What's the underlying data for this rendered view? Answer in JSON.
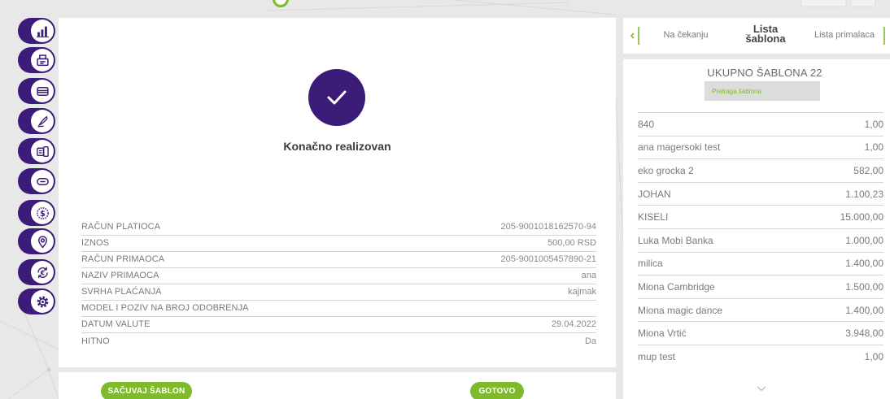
{
  "colors": {
    "brand_purple": "#3b1c78",
    "brand_green": "#7fba2c",
    "text_grey": "#777777",
    "search_background": "#dcdcdc"
  },
  "sidebar": {
    "items": [
      {
        "icon": "bar-chart-icon"
      },
      {
        "icon": "printer-icon"
      },
      {
        "icon": "card-icon"
      },
      {
        "icon": "pen-icon"
      },
      {
        "icon": "transfer-icon"
      },
      {
        "icon": "minus-icon"
      },
      {
        "icon": "dollar-icon"
      },
      {
        "icon": "location-pin-icon"
      },
      {
        "icon": "euro-exchange-icon"
      },
      {
        "icon": "gear-icon"
      }
    ]
  },
  "confirmation": {
    "icon": "check-icon",
    "status_text": "Konačno realizovan"
  },
  "details": [
    {
      "label": "RAČUN PLATIOCA",
      "value": "205-9001018162570-94"
    },
    {
      "label": "IZNOS",
      "value": "500,00 RSD"
    },
    {
      "label": "RAČUN PRIMAOCA",
      "value": "205-9001005457890-21"
    },
    {
      "label": "NAZIV PRIMAOCA",
      "value": "ana"
    },
    {
      "label": "SVRHA PLAĆANJA",
      "value": "kajmak"
    },
    {
      "label": "MODEL I POZIV NA BROJ ODOBRENJA",
      "value": ""
    },
    {
      "label": "DATUM VALUTE",
      "value": "29.04.2022"
    },
    {
      "label": "HITNO",
      "value": "Da"
    }
  ],
  "actions": {
    "save_template_label": "SAČUVAJ ŠABLON",
    "done_label": "GOTOVO"
  },
  "tabs": {
    "prev_icon": "chevron-left-icon",
    "next_icon": "chevron-right-icon",
    "items": [
      {
        "label": "Na čekanju",
        "active": false
      },
      {
        "label": "Lista šablona",
        "active": true
      },
      {
        "label": "Lista primalaca",
        "active": false
      }
    ]
  },
  "templates": {
    "total_label": "UKUPNO ŠABLONA",
    "total_count": 22,
    "search_placeholder": "Pretraga šablona",
    "more_icon": "chevron-down-icon",
    "items": [
      {
        "name": "840",
        "amount": "1,00"
      },
      {
        "name": "ana magersoki test",
        "amount": "1,00"
      },
      {
        "name": "eko grocka 2",
        "amount": "582,00"
      },
      {
        "name": "JOHAN",
        "amount": "1.100,23"
      },
      {
        "name": "KISELI",
        "amount": "15.000,00"
      },
      {
        "name": "Luka Mobi Banka",
        "amount": "1.000,00"
      },
      {
        "name": "milica",
        "amount": "1.400,00"
      },
      {
        "name": "Miona Cambridge",
        "amount": "1.500,00"
      },
      {
        "name": "Miona magic dance",
        "amount": "1.400,00"
      },
      {
        "name": "Miona Vrtić",
        "amount": "3.948,00"
      },
      {
        "name": "mup test",
        "amount": "1,00"
      }
    ]
  }
}
